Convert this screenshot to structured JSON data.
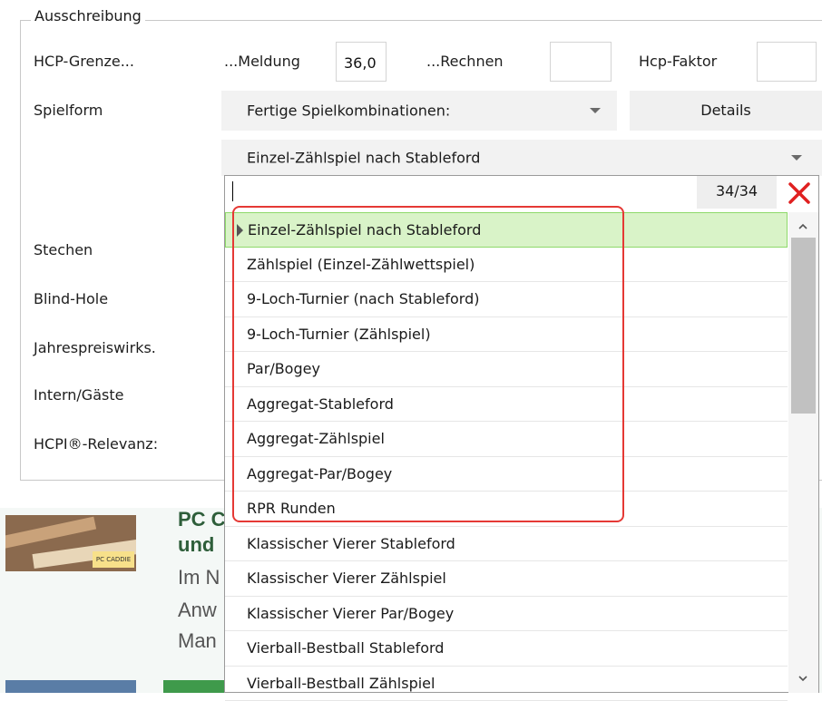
{
  "section": {
    "title": "Ausschreibung"
  },
  "fields": {
    "hcp_grenze_label": "HCP-Grenze...",
    "meldung_label": "...Meldung",
    "meldung_value": "36,0",
    "rechnen_label": "...Rechnen",
    "rechnen_value": "",
    "hcp_faktor_label": "Hcp-Faktor",
    "hcp_faktor_value": "",
    "spielform_label": "Spielform",
    "spielform_combo": "Fertige Spielkombinationen:",
    "details_button": "Details",
    "spielform_value": "Einzel-Zählspiel nach Stableford",
    "stechen_label": "Stechen",
    "blind_hole_label": "Blind-Hole",
    "jahrespreis_label": "Jahrespreiswirks.",
    "intern_gaeste_label": "Intern/Gäste",
    "hcpi_label": "HCPI®-Relevanz:"
  },
  "dropdown": {
    "search_value": "",
    "counter": "34/34",
    "items": [
      "Einzel-Zählspiel nach Stableford",
      "Zählspiel (Einzel-Zählwettspiel)",
      "9-Loch-Turnier (nach Stableford)",
      "9-Loch-Turnier (Zählspiel)",
      "Par/Bogey",
      "Aggregat-Stableford",
      "Aggregat-Zählspiel",
      "Aggregat-Par/Bogey",
      "RPR Runden",
      "Klassischer Vierer Stableford",
      "Klassischer Vierer Zählspiel",
      "Klassischer Vierer Par/Bogey",
      "Vierball-Bestball Stableford",
      "Vierball-Bestball Zählspiel"
    ],
    "selected_index": 0
  },
  "background_ad": {
    "badge": "PC CADDIE",
    "line1": "PC C",
    "line2": "und",
    "line3": "Im N",
    "line4": "Anw",
    "line5": "Man"
  },
  "colors": {
    "selected_bg": "#d9f3c8",
    "highlight_border": "#e53935",
    "close_icon": "#e02020"
  }
}
